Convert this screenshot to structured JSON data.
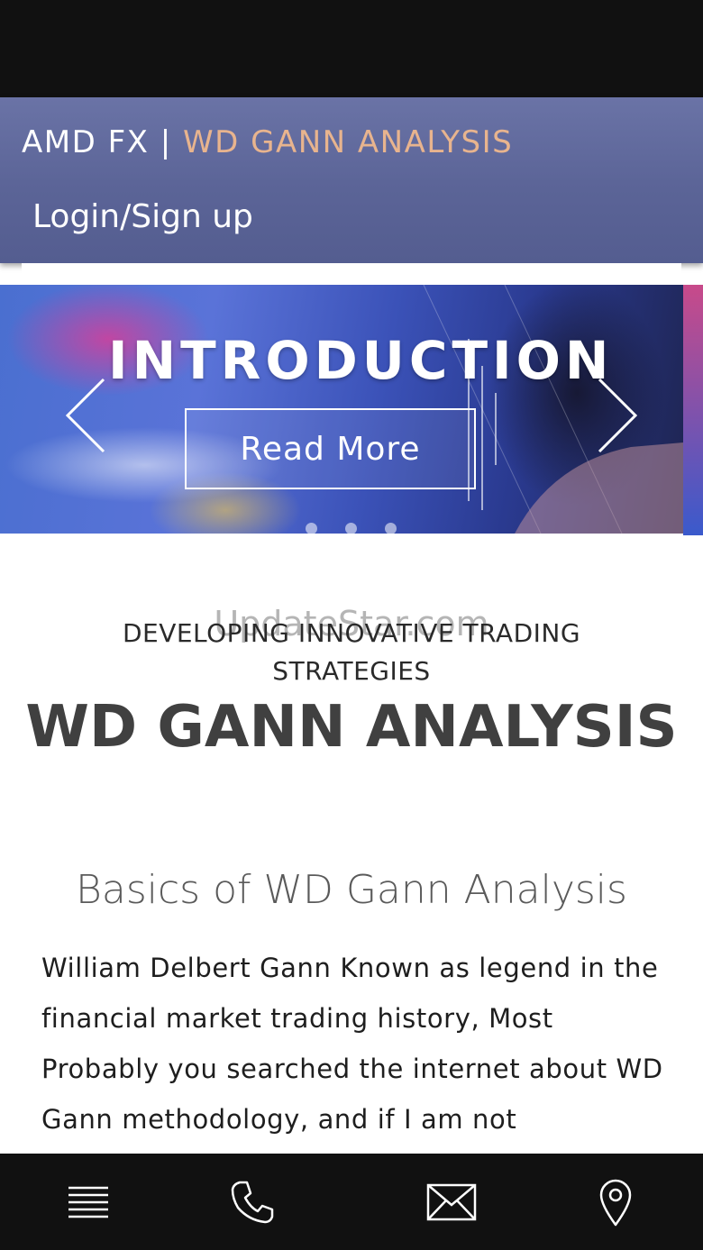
{
  "header": {
    "brand_primary": "AMD FX | ",
    "brand_secondary": "WD GANN ANALYSIS",
    "login_label": "Login/Sign up"
  },
  "slider": {
    "title": "INTRODUCTION",
    "button_label": "Read More",
    "dots_count": 3,
    "active_dot": 0
  },
  "content": {
    "watermark": "UpdateStar.com",
    "tagline": "DEVELOPING INNOVATIVE TRADING STRATEGIES",
    "title": "WD GANN ANALYSIS",
    "subtitle": "Basics of WD Gann Analysis",
    "body": "William Delbert Gann Known as legend in the financial market trading history, Most Probably you searched the internet about WD Gann methodology, and if I am not"
  },
  "bottom_nav": {
    "items": [
      {
        "icon": "menu-icon"
      },
      {
        "icon": "phone-icon"
      },
      {
        "icon": "mail-icon"
      },
      {
        "icon": "location-pin-icon"
      }
    ]
  },
  "colors": {
    "header_bg": "#5b6497",
    "brand_accent": "#e8b48e",
    "bar_bg": "#111111",
    "title_text": "#404040"
  }
}
